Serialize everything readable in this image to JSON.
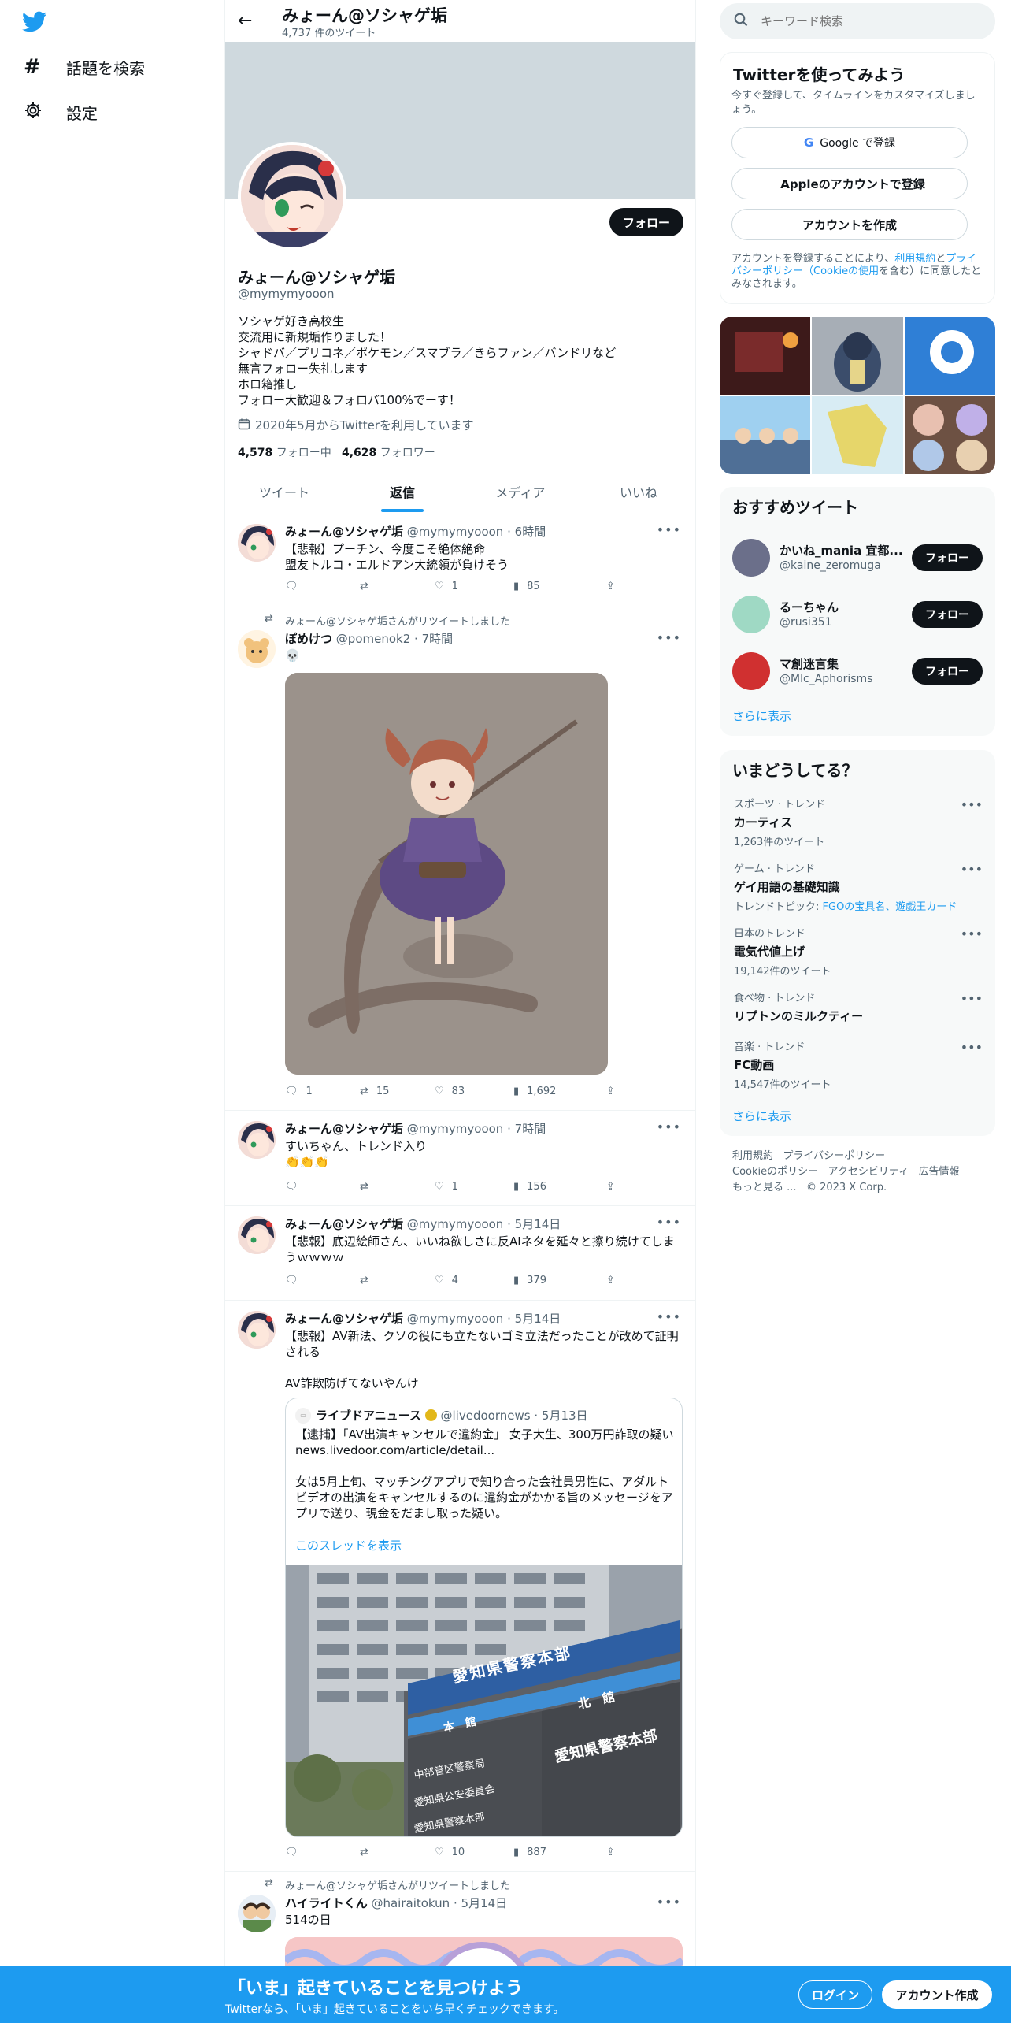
{
  "nav": {
    "explore_label": "話題を検索",
    "settings_label": "設定"
  },
  "profile_header": {
    "name": "みょーん@ソシャゲ垢",
    "tweet_count": "4,737 件のツイート"
  },
  "profile": {
    "name": "みょーん@ソシャゲ垢",
    "handle": "@mymymyooon",
    "follow_label": "フォロー",
    "bio_lines": [
      "ソシャゲ好き高校生",
      "交流用に新規垢作りました！",
      "シャドバ／プリコネ／ポケモン／スマブラ／きらファン／バンドリなど",
      "無言フォロー失礼します",
      "ホロ箱推し",
      "フォロー大歓迎＆フォロバ100%でーす！"
    ],
    "joined": "2020年5月からTwitterを利用しています",
    "following_count": "4,578",
    "following_label": "フォロー中",
    "followers_count": "4,628",
    "followers_label": "フォロワー"
  },
  "tabs": [
    "ツイート",
    "返信",
    "メディア",
    "いいね"
  ],
  "tweets": [
    {
      "name": "みょーん@ソシャゲ垢",
      "handle": "@mymymyooon",
      "time": "6時間",
      "text": "【悲報】プーチン、今度こそ絶体絶命\n盟友トルコ・エルドアン大統領が負けそう",
      "replies": "",
      "retweets": "",
      "likes": "1",
      "views": "85"
    },
    {
      "retweet_note": "みょーん@ソシャゲ垢さんがリツイートしました",
      "name": "ぽめけつ",
      "handle": "@pomenok2",
      "time": "7時間",
      "text": "💀",
      "replies": "1",
      "retweets": "15",
      "likes": "83",
      "views": "1,692"
    },
    {
      "name": "みょーん@ソシャゲ垢",
      "handle": "@mymymyooon",
      "time": "7時間",
      "text": "すいちゃん、トレンド入り\n👏👏👏",
      "replies": "",
      "retweets": "",
      "likes": "1",
      "views": "156"
    },
    {
      "name": "みょーん@ソシャゲ垢",
      "handle": "@mymymyooon",
      "time": "5月14日",
      "text": "【悲報】底辺絵師さん、いいね欲しさに反AIネタを延々と擦り続けてしまうｗｗｗｗ",
      "replies": "",
      "retweets": "",
      "likes": "4",
      "views": "379"
    },
    {
      "name": "みょーん@ソシャゲ垢",
      "handle": "@mymymyooon",
      "time": "5月14日",
      "text": "【悲報】AV新法、クソの役にも立たないゴミ立法だったことが改めて証明される\n\nAV詐欺防げてないやんけ",
      "replies": "",
      "retweets": "",
      "likes": "10",
      "views": "887",
      "quote": {
        "name": "ライブドアニュース",
        "handle": "@livedoornews",
        "time": "5月13日",
        "text": "【逮捕】「AV出演キャンセルで違約金」 女子大生、300万円詐取の疑い\nnews.livedoor.com/article/detail...\n\n女は5月上旬、マッチングアプリで知り合った会社員男性に、アダルトビデオの出演をキャンセルするのに違約金がかかる旨のメッセージをアプリで送り、現金をだまし取った疑い。",
        "thread_link": "このスレッドを表示",
        "sign_main": "愛知県警察本部",
        "sign_top": "愛知県警察本部",
        "sign_left_head": "本　館",
        "sign_right_head": "北　館",
        "sign_rows": [
          "中部管区警察局",
          "愛知県公安委員会",
          "愛知県警察本部"
        ]
      }
    },
    {
      "retweet_note": "みょーん@ソシャゲ垢さんがリツイートしました",
      "name": "ハイライトくん",
      "handle": "@hairaitokun",
      "time": "5月14日",
      "text": "514の日"
    }
  ],
  "search": {
    "placeholder": "キーワード検索"
  },
  "signup": {
    "title": "Twitterを使ってみよう",
    "subtitle": "今すぐ登録して、タイムラインをカスタマイズしましょう。",
    "google_label": "Google で登録",
    "apple_label": "Appleのアカウントで登録",
    "create_label": "アカウントを作成",
    "legal_pre": "アカウントを登録することにより、",
    "legal_terms": "利用規約",
    "legal_and": "と",
    "legal_privacy": "プライバシーポリシー（Cookieの使用",
    "legal_post": "を含む）に同意したとみなされます。"
  },
  "recommend": {
    "title": "おすすめツイート",
    "users": [
      {
        "name": "かいね_mania 宜都...",
        "handle": "@kaine_zeromuga",
        "button": "フォロー"
      },
      {
        "name": "るーちゃん",
        "handle": "@rusi351",
        "button": "フォロー"
      },
      {
        "name": "マ創迷言集",
        "handle": "@Mlc_Aphorisms",
        "button": "フォロー"
      }
    ],
    "show_more": "さらに表示"
  },
  "trends": {
    "title": "いまどうしてる？",
    "items": [
      {
        "category": "スポーツ · トレンド",
        "name": "カーティス",
        "count": "1,263件のツイート"
      },
      {
        "category": "ゲーム · トレンド",
        "name": "ゲイ用語の基礎知識",
        "count": "",
        "topic_prefix": "トレンドトピック: ",
        "topic": "FGOの宝具名、遊戯王カード"
      },
      {
        "category": "日本のトレンド",
        "name": "電気代値上げ",
        "count": "19,142件のツイート"
      },
      {
        "category": "食べ物 · トレンド",
        "name": "リプトンのミルクティー",
        "count": ""
      },
      {
        "category": "音楽 · トレンド",
        "name": "FC動画",
        "count": "14,547件のツイート"
      }
    ],
    "show_more": "さらに表示"
  },
  "footer": {
    "links": [
      "利用規約",
      "プライバシーポリシー",
      "Cookieのポリシー",
      "アクセシビリティ",
      "広告情報",
      "もっと見る ..."
    ],
    "copyright": "© 2023 X Corp."
  },
  "bottom_bar": {
    "headline": "「いま」起きていることを見つけよう",
    "sub": "Twitterなら、「いま」起きていることをいち早くチェックできます。",
    "login": "ログイン",
    "signup": "アカウント作成"
  },
  "colors": {
    "accent": "#1d9bf0",
    "text": "#0f1419",
    "muted": "#536471",
    "banner": "#cfd9de"
  }
}
